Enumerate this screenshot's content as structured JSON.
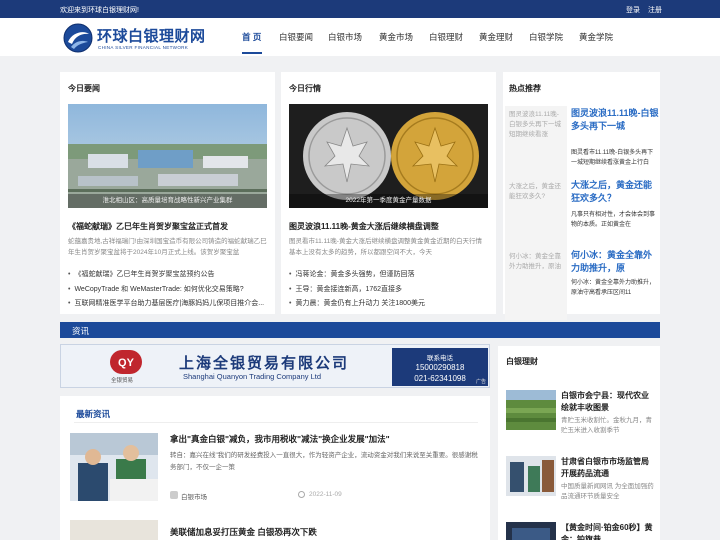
{
  "topbar": {
    "welcome": "欢迎来到环球白银理财网!",
    "login": "登录",
    "register": "注册"
  },
  "logo": {
    "cn": "环球白银理财网",
    "en": "CHINA SILVER FINANCIAL NETWORK"
  },
  "nav": [
    "首 页",
    "白银要闻",
    "白银市场",
    "黄金市场",
    "白银理财",
    "黄金理财",
    "白银学院",
    "黄金学院"
  ],
  "today_news": {
    "title": "今日要闻",
    "caption": "淮北相山区：高质量培育战略性新兴产业集群",
    "lead": "《福蛇献瑞》乙巳年生肖贺岁聚宝盆正式首发",
    "summary": "蛇蕴嘉贵地,古祥福瑞门!由深圳国宝造币有限公司铸造的福蛇献瑞乙巳年生肖贺岁聚宝盆将于2024年10月正式上线。该贺岁聚宝盆",
    "items": [
      "《福蛇献瑞》乙巳年生肖贺岁聚宝盆预约公告",
      "WeCopyTrade 和 WeMasterTrade: 如何优化交易策略?",
      "互联网精准医学平台助力基层医疗|海豚妈妈儿保项目推介会..."
    ]
  },
  "today_market": {
    "title": "今日行情",
    "caption": "2022年第一季度黄金产量数据",
    "lead": "图灵波浪11.11晚-黄金大涨后继续横盘调整",
    "summary": "图灵看市11.11晚-黄金大涨后继续横盘调整黄金黄金近期的白天行情基本上没有太多的趋势，所以都跟空间不大，今天",
    "items": [
      "冯蒋论金：黄金多头强势，但谨防回落",
      "王导：黄金接连新高，1762直接多",
      "黄力晨：黄金仍有上升动力 关注1800美元"
    ]
  },
  "hot": {
    "title": "热点推荐",
    "items": [
      {
        "thumb": "图灵波浪11.11晚-白银多头再下一城短期继续看涨",
        "title": "图灵波浪11.11晚-白银多头再下一城",
        "summary": "图灵看市11.11晚-白银多头再下一城短期继续看涨黄金上行白"
      },
      {
        "thumb": "大涨之后，黄金还能狂欢多久?",
        "title": "大涨之后，黄金还能狂欢多久？",
        "summary": "凡事只有相对性，才会体会到事物的本质。正如黄金在"
      },
      {
        "thumb": "何小冰：黄金全靠外力助推升，原油",
        "title": "何小冰：黄金全靠外力助推升，原",
        "summary": "何小冰：黄金全靠外力助推升，原油守高看承压区间11"
      }
    ]
  },
  "zixun": "资讯",
  "ad": {
    "brand": "全银贸易",
    "cn": "上海全银贸易有限公司",
    "en": "Shanghai Quanyon Trading Company Ltd",
    "contact": "联系电话",
    "phone1": "15000290818",
    "phone2": "021-62341098",
    "tag": "广告"
  },
  "latest": {
    "title": "最新资讯",
    "lead": "拿出\"真金白银\"减负，我市用税收\"减法\"换企业发展\"加法\"",
    "summary": "转自：嘉兴在线\"我们的研发经费投入一直很大，作为轻资产企业，流动资金对我们来说至关重要。很感谢税务部门，不仅一企一策",
    "tag": "白银市场",
    "date": "2022-11-09",
    "next": "美联储加息妥打压黄金 白银恐再次下跌"
  },
  "licai": {
    "title": "白银理财",
    "items": [
      {
        "title": "白银市会宁县：现代农业绘就丰收图景",
        "summary": "青贮玉米收割忙。金秋九月，青贮玉米进入收割季节"
      },
      {
        "title": "甘肃省白银市市场监管局开展药品流通",
        "summary": "中国质量新闻网讯 为全面加强药品流通环节质量安全"
      },
      {
        "title": "【黄金时间·铂金60秒】黄金：铂旗巷",
        "summary": ""
      }
    ]
  },
  "colors": {
    "brand_blue": "#1c4a9a",
    "link_blue": "#2a6cc4"
  }
}
